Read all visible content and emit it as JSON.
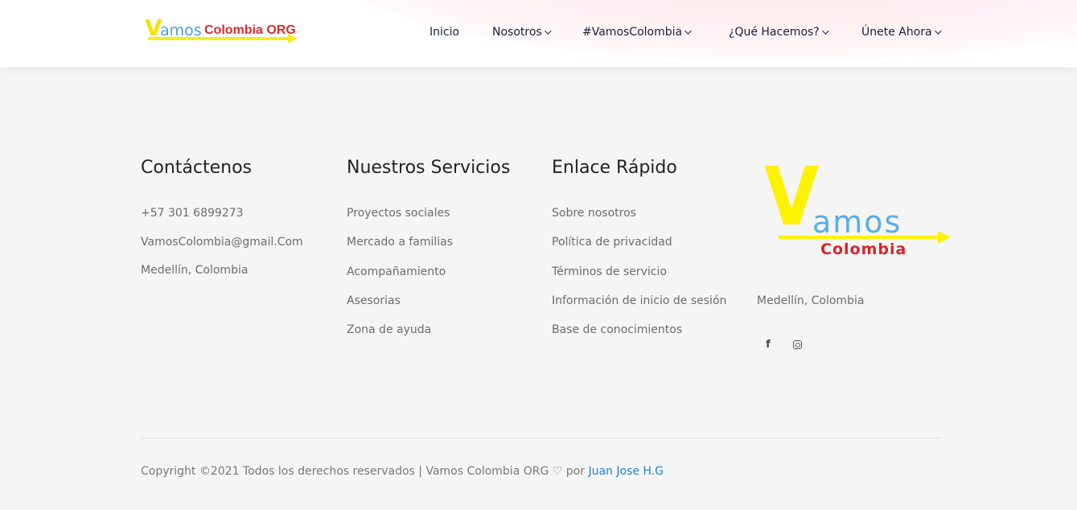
{
  "header": {
    "logo": {
      "letter_v": "V",
      "word_amos": "amos",
      "word_colombia": "Colombia ORG",
      "logo_icon": "vamos-colombia-logo"
    },
    "nav": [
      {
        "label": "Inicio",
        "has_dropdown": false
      },
      {
        "label": "Nosotros",
        "has_dropdown": true
      },
      {
        "label": "#VamosColombia",
        "has_dropdown": true
      },
      {
        "label": "¿Qué Hacemos?",
        "has_dropdown": true
      },
      {
        "label": "Únete Ahora",
        "has_dropdown": true
      }
    ]
  },
  "footer": {
    "contact": {
      "title": "Contáctenos",
      "items": [
        "+57 301 6899273",
        "VamosColombia@gmail.Com",
        "Medellín, Colombia"
      ]
    },
    "services": {
      "title": "Nuestros Servicios",
      "items": [
        "Proyectos sociales",
        "Mercado a familias",
        "Acompañamiento",
        "Asesorias",
        "Zona de ayuda"
      ]
    },
    "quick_links": {
      "title": "Enlace Rápido",
      "items": [
        "Sobre nosotros",
        "Política de privacidad",
        "Términos de servicio",
        "Información de inicio de sesión",
        "Base de conocimientos"
      ]
    },
    "brand": {
      "letter_v": "V",
      "word_amos": "amos",
      "word_colombia": "Colombia",
      "city": "Medellín, Colombia",
      "social": [
        {
          "icon": "facebook-icon",
          "glyph": "f"
        },
        {
          "icon": "instagram-icon"
        }
      ]
    },
    "copyright": {
      "text": "Copyright ©2021 Todos los derechos reservados | Vamos Colombia ORG",
      "heart": "♡",
      "by": "por",
      "author": "Juan Jose H.G"
    }
  },
  "colors": {
    "nav_text": "#1a1f3a",
    "logo_yellow": "#fff200",
    "logo_blue": "#55aef0",
    "logo_red": "#d8232a",
    "link_blue": "#1e7fd6",
    "footer_bg": "#f6f5f5"
  }
}
